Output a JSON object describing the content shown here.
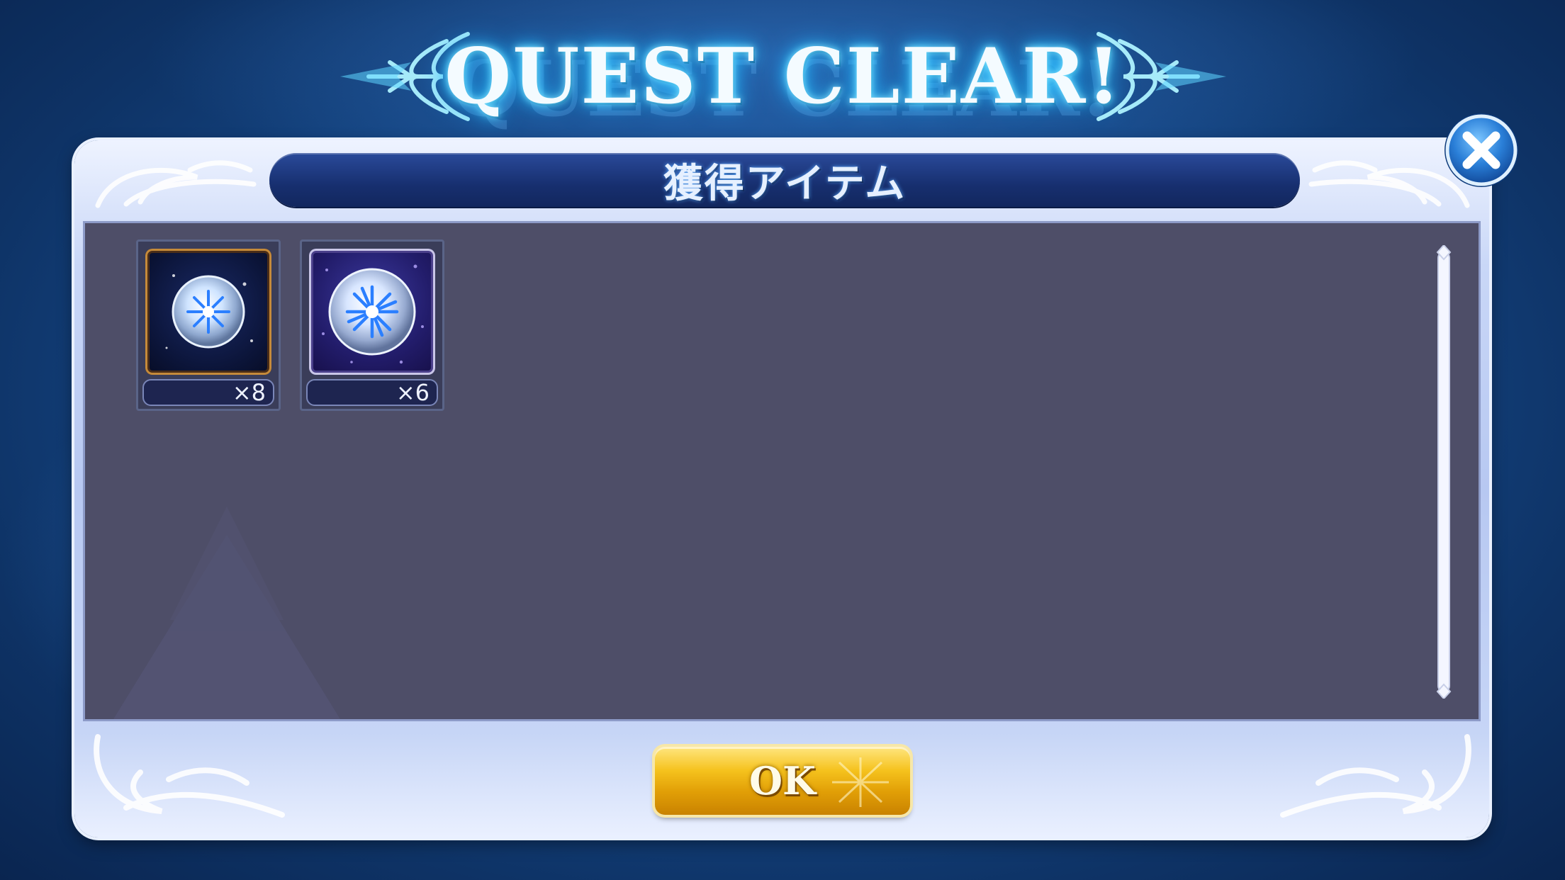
{
  "banner": {
    "title": "QUEST CLEAR!"
  },
  "dialog": {
    "header": "獲得アイテム",
    "items": [
      {
        "icon": "crystal-orb-icon",
        "quantity": "×8",
        "frame": "dark-gold"
      },
      {
        "icon": "crystal-orb-large-icon",
        "quantity": "×6",
        "frame": "purple-starry"
      }
    ],
    "ok_label": "OK",
    "close_icon": "close-icon"
  },
  "colors": {
    "background": "#174c8e",
    "panel_frame": "#c9d7f7",
    "content_bg": "#4e4e68",
    "header_bar": "#172f6f",
    "ok_gold": "#f5c21d",
    "close_blue": "#2a7fd8"
  }
}
